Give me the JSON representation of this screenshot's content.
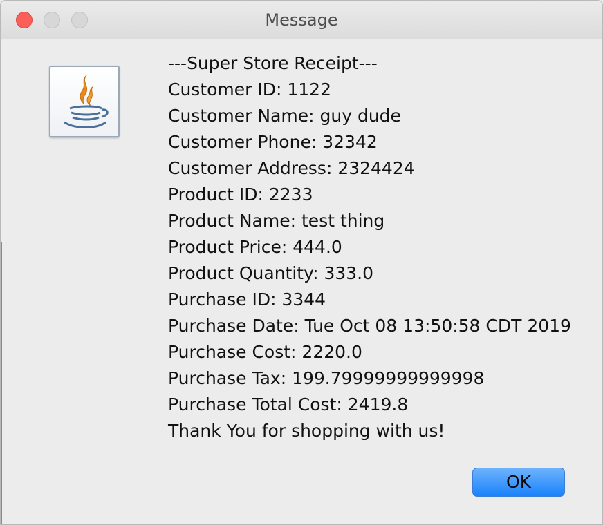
{
  "window": {
    "title": "Message"
  },
  "icons": {
    "app_icon": "java-coffee-cup-icon"
  },
  "receipt": {
    "lines": [
      "---Super Store Receipt---",
      "Customer ID: 1122",
      "Customer Name: guy dude",
      "Customer Phone: 32342",
      "Customer Address: 2324424",
      "Product ID: 2233",
      "Product Name: test thing",
      "Product Price: 444.0",
      "Product Quantity: 333.0",
      "Purchase ID: 3344",
      "Purchase Date: Tue Oct 08 13:50:58 CDT 2019",
      "Purchase Cost: 2220.0",
      "Purchase Tax: 199.79999999999998",
      "Purchase Total Cost: 2419.8",
      "Thank You for shopping with us!"
    ]
  },
  "buttons": {
    "ok_label": "OK"
  },
  "colors": {
    "close": "#fc5f57",
    "button_accent": "#1a82fb",
    "icon_flame": "#e8891c",
    "icon_cup": "#4a6f9a"
  }
}
